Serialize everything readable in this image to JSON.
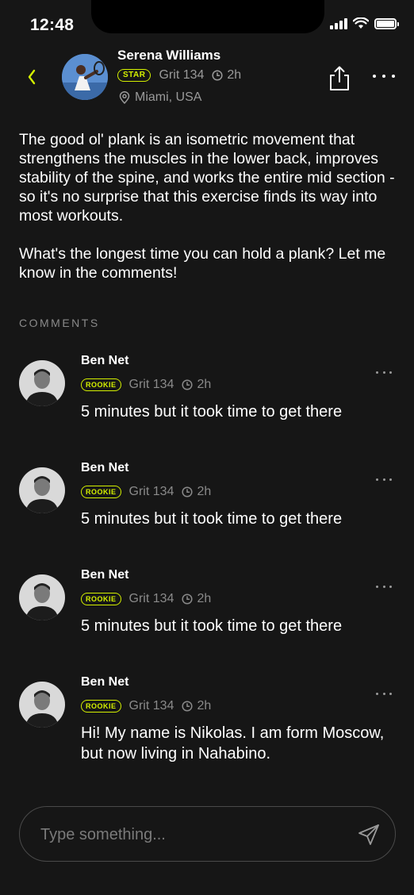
{
  "status_bar": {
    "time": "12:48"
  },
  "post": {
    "author": "Serena Williams",
    "badge": "STAR",
    "grit": "Grit 134",
    "age": "2h",
    "location": "Miami, USA",
    "paragraphs": [
      "The good ol' plank is an isometric movement that strengthens the muscles in the lower back, improves stability of the spine, and works the entire mid section - so it's no surprise that this exercise finds its way into most workouts.",
      "What's the longest time you can hold a plank? Let me know in the comments!"
    ]
  },
  "comments_heading": "COMMENTS",
  "comments": [
    {
      "name": "Ben Net",
      "badge": "ROOKIE",
      "grit": "Grit 134",
      "age": "2h",
      "text": "5 minutes but it took time to get there"
    },
    {
      "name": "Ben Net",
      "badge": "ROOKIE",
      "grit": "Grit 134",
      "age": "2h",
      "text": "5 minutes but it took time to get there"
    },
    {
      "name": "Ben Net",
      "badge": "ROOKIE",
      "grit": "Grit 134",
      "age": "2h",
      "text": "5 minutes but it took time to get there"
    },
    {
      "name": "Ben Net",
      "badge": "ROOKIE",
      "grit": "Grit 134",
      "age": "2h",
      "text": "Hi! My name is Nikolas. I am form Moscow, but now living in Nahabino."
    }
  ],
  "composer": {
    "placeholder": "Type something..."
  },
  "colors": {
    "accent": "#d4f000",
    "background": "#161616",
    "muted": "#8a8a8a"
  }
}
